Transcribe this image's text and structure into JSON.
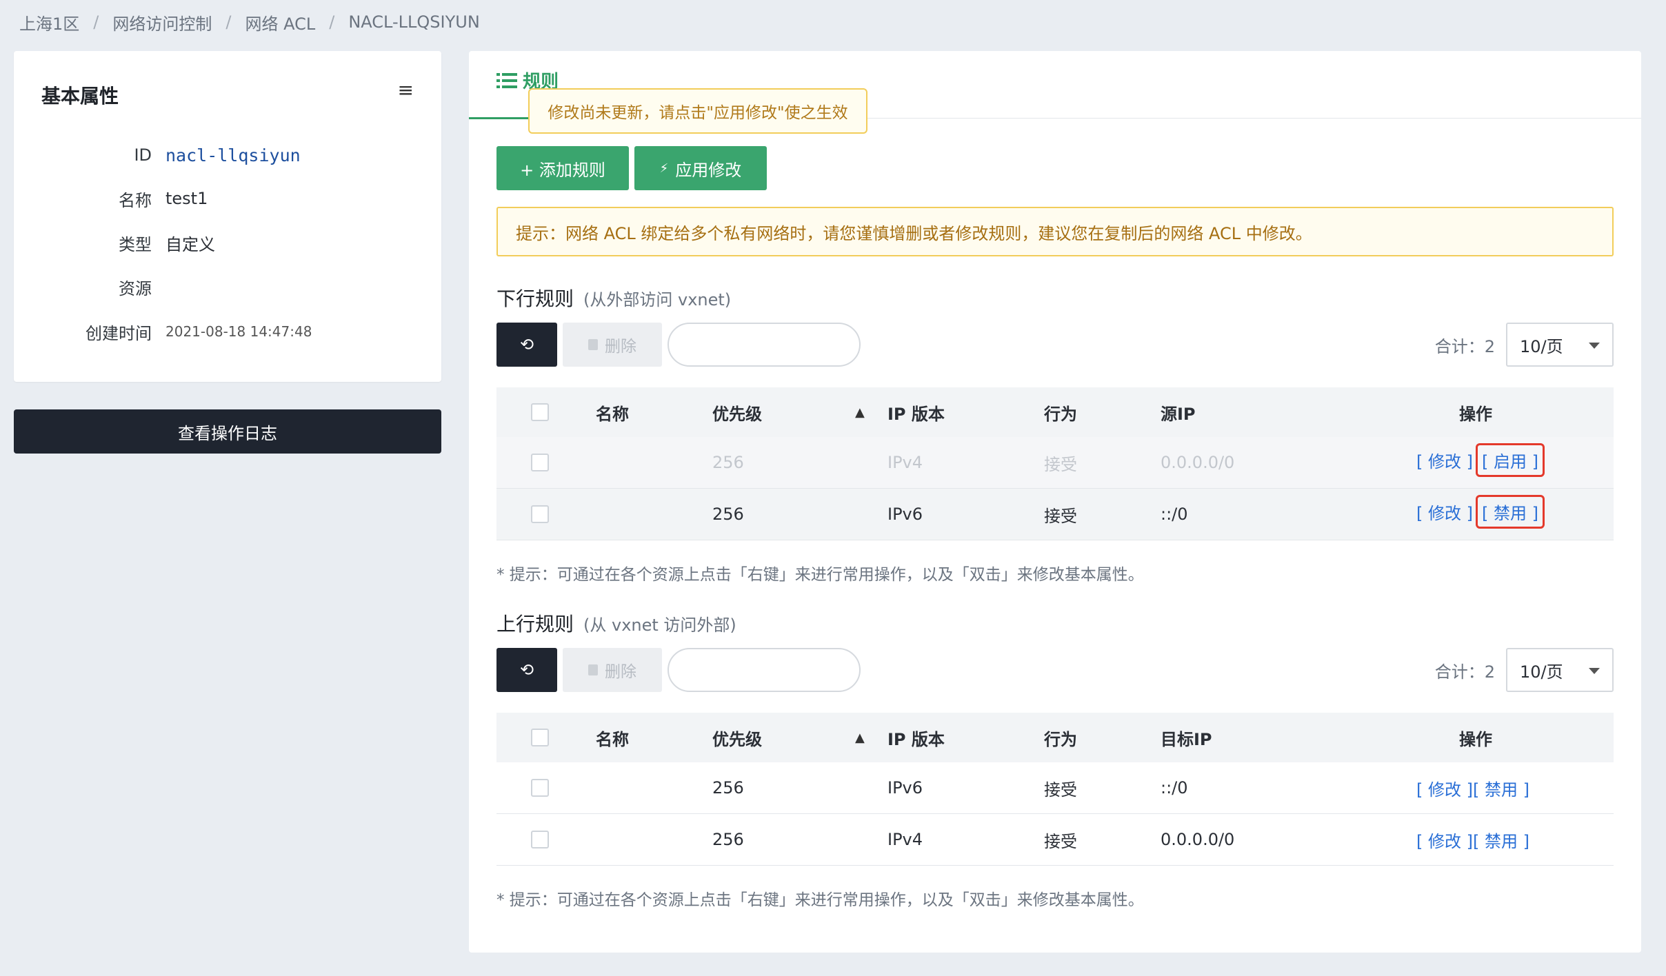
{
  "breadcrumb": [
    "上海1区",
    "网络访问控制",
    "网络 ACL",
    "NACL-LLQSIYUN"
  ],
  "left": {
    "title": "基本属性",
    "menu_icon": "≡",
    "props": [
      {
        "label": "ID",
        "value": "nacl-llqsiyun"
      },
      {
        "label": "名称",
        "value": "test1"
      },
      {
        "label": "类型",
        "value": "自定义"
      },
      {
        "label": "资源",
        "value": ""
      },
      {
        "label": "创建时间",
        "value": "2021-08-18 14:47:48"
      }
    ],
    "log_button": "查看操作日志"
  },
  "main": {
    "tab_label": "规则",
    "tooltip": "修改尚未更新，请点击\"应用修改\"使之生效",
    "add_rule": "+ 添加规则",
    "apply": "应用修改",
    "apply_icon": "⚡",
    "notice": "提示：网络 ACL 绑定给多个私有网络时，请您谨慎增删或者修改规则，建议您在复制后的网络 ACL 中修改。",
    "delete_label": "删除",
    "refresh_icon": "⟲",
    "hint": "* 提示：可通过在各个资源上点击「右键」来进行常用操作，以及「双击」来修改基本属性。",
    "inbound": {
      "title": "下行规则",
      "subtitle": "(从外部访问 vxnet)",
      "total": "合计：2",
      "page_size": "10/页",
      "headers": {
        "name": "名称",
        "priority": "优先级",
        "ip_version": "IP 版本",
        "action": "行为",
        "ip": "源IP",
        "ops": "操作"
      },
      "rows": [
        {
          "name": "",
          "priority": "256",
          "ip_version": "IPv4",
          "action": "接受",
          "ip": "0.0.0.0/0",
          "edit": "[ 修改 ]",
          "toggle": "[ 启用 ]"
        },
        {
          "name": "",
          "priority": "256",
          "ip_version": "IPv6",
          "action": "接受",
          "ip": "::/0",
          "edit": "[ 修改 ]",
          "toggle": "[ 禁用 ]"
        }
      ]
    },
    "outbound": {
      "title": "上行规则",
      "subtitle": "(从 vxnet 访问外部)",
      "total": "合计：2",
      "page_size": "10/页",
      "headers": {
        "name": "名称",
        "priority": "优先级",
        "ip_version": "IP 版本",
        "action": "行为",
        "ip": "目标IP",
        "ops": "操作"
      },
      "rows": [
        {
          "name": "",
          "priority": "256",
          "ip_version": "IPv6",
          "action": "接受",
          "ip": "::/0",
          "edit": "[ 修改 ]",
          "toggle": "[ 禁用 ]"
        },
        {
          "name": "",
          "priority": "256",
          "ip_version": "IPv4",
          "action": "接受",
          "ip": "0.0.0.0/0",
          "edit": "[ 修改 ]",
          "toggle": "[ 禁用 ]"
        }
      ]
    }
  },
  "colors": {
    "accent": "#3aa56e",
    "link": "#2a6fd6",
    "highlight": "#e4392b",
    "dark": "#1f2530"
  }
}
